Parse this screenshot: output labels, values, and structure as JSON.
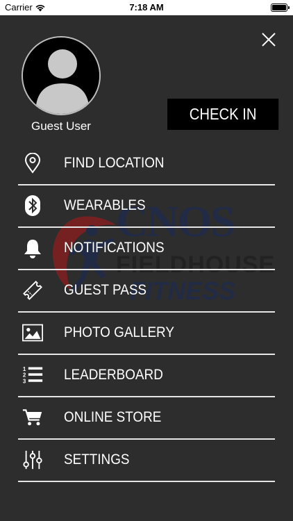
{
  "status_bar": {
    "carrier": "Carrier",
    "time": "7:18 AM"
  },
  "profile": {
    "name": "Guest User"
  },
  "actions": {
    "check_in_label": "CHECK IN"
  },
  "watermark": {
    "line1": "CNOS",
    "line2": "FIELDHOUSE",
    "line3": "FITNESS"
  },
  "menu": {
    "items": [
      {
        "label": "FIND LOCATION",
        "icon": "location-pin-icon"
      },
      {
        "label": "WEARABLES",
        "icon": "bluetooth-icon"
      },
      {
        "label": "NOTIFICATIONS",
        "icon": "bell-icon"
      },
      {
        "label": "GUEST PASS",
        "icon": "ticket-icon"
      },
      {
        "label": "PHOTO GALLERY",
        "icon": "image-icon"
      },
      {
        "label": "LEADERBOARD",
        "icon": "numbered-list-icon"
      },
      {
        "label": "ONLINE STORE",
        "icon": "shopping-cart-icon"
      },
      {
        "label": "SETTINGS",
        "icon": "sliders-icon"
      }
    ]
  },
  "colors": {
    "background": "#2d2d2d",
    "divider": "#e6e6e6",
    "button": "#000000"
  }
}
